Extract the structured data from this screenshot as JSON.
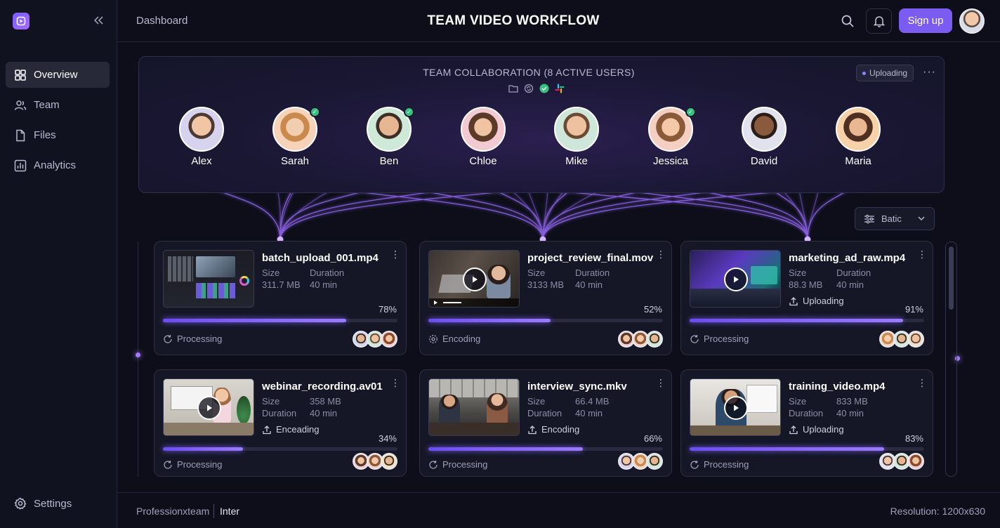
{
  "sidebar": {
    "items": [
      {
        "label": "Overview",
        "icon": "grid-icon"
      },
      {
        "label": "Team",
        "icon": "users-icon"
      },
      {
        "label": "Files",
        "icon": "file-icon"
      },
      {
        "label": "Analytics",
        "icon": "chart-icon"
      }
    ],
    "settings_label": "Settings"
  },
  "header": {
    "breadcrumb": "Dashboard",
    "title": "TEAM VIDEO WORKFLOW",
    "signup_label": "Sign up"
  },
  "collab": {
    "title": "TEAM COLLABORATION (8 ACTIVE USERS)",
    "status": "Uploading",
    "more": "···",
    "members": [
      {
        "name": "Alex",
        "verified": false
      },
      {
        "name": "Sarah",
        "verified": true
      },
      {
        "name": "Ben",
        "verified": true
      },
      {
        "name": "Chloe",
        "verified": false
      },
      {
        "name": "Mike",
        "verified": false
      },
      {
        "name": "Jessica",
        "verified": true
      },
      {
        "name": "David",
        "verified": false
      },
      {
        "name": "Maria",
        "verified": false
      }
    ]
  },
  "filter": {
    "label": "Batic"
  },
  "labels": {
    "size": "Size",
    "duration": "Duration",
    "menu": "⋮"
  },
  "cards": [
    {
      "file": "batch_upload_001.mp4",
      "size": "311.7 MB",
      "duration": "40 min",
      "action": "",
      "percent": "78%",
      "progress": 0.78,
      "status": "Processing"
    },
    {
      "file": "project_review_final.mov",
      "size": "3133 MB",
      "duration": "40 min",
      "action": "",
      "percent": "52%",
      "progress": 0.52,
      "status": "Encoding"
    },
    {
      "file": "marketing_ad_raw.mp4",
      "size": "88.3 MB",
      "duration": "40 min",
      "action": "Uploading",
      "percent": "91%",
      "progress": 0.91,
      "status": "Processing"
    },
    {
      "file": "webinar_recording.av01",
      "size": "358 MB",
      "duration": "40 min",
      "action": "Enceading",
      "percent": "34%",
      "progress": 0.34,
      "status": "Processing"
    },
    {
      "file": "interview_sync.mkv",
      "size": "66.4 MB",
      "duration": "40 min",
      "action": "Encoding",
      "percent": "66%",
      "progress": 0.66,
      "status": "Processing"
    },
    {
      "file": "training_video.mp4",
      "size": "833 MB",
      "duration": "40 min",
      "action": "Uploading",
      "percent": "83%",
      "progress": 0.83,
      "status": "Processing"
    }
  ],
  "footer": {
    "left": "Professionxteam",
    "font": "Inter",
    "resolution": "Resolution: 1200x630"
  },
  "colors": {
    "accent": "#7a5cf0",
    "glow": "#a678ff",
    "success": "#35c27d"
  }
}
